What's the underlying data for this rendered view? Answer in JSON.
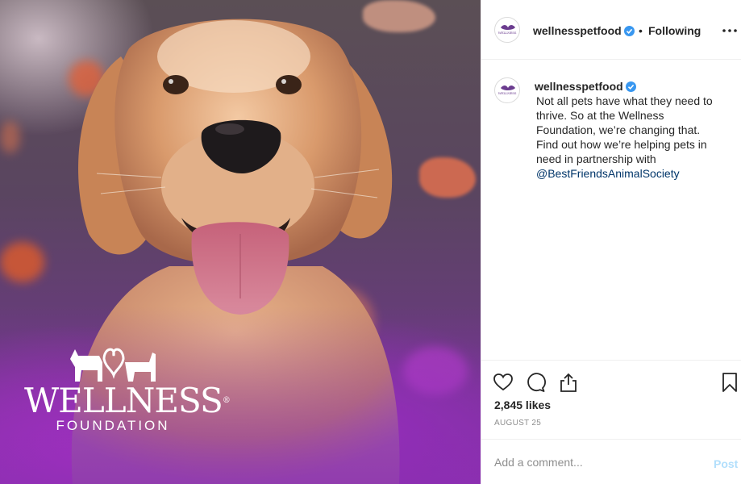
{
  "post": {
    "image_alt_icon": "golden-retriever-photo",
    "logo": {
      "wordmark": "WELLNESS",
      "registered": "®",
      "subtitle": "FOUNDATION"
    }
  },
  "header": {
    "username": "wellnesspetfood",
    "verified_icon": "verified-badge-icon",
    "separator": "•",
    "follow_status": "Following",
    "more_icon": "more-options-icon",
    "avatar_text": "WELLNESS"
  },
  "caption": {
    "username": "wellnesspetfood",
    "text": "Not all pets have what they need to thrive. So at the Wellness Foundation, we’re changing that. Find out how we’re helping pets in need in partnership with",
    "mention": "@BestFriendsAnimalSociety"
  },
  "actions": {
    "like_icon": "heart-icon",
    "comment_icon": "comment-bubble-icon",
    "share_icon": "share-icon",
    "save_icon": "bookmark-icon",
    "likes": "2,845 likes",
    "date": "AUGUST 25"
  },
  "comment_box": {
    "placeholder": "Add a comment...",
    "post_label": "Post"
  },
  "colors": {
    "accent_link": "#003569",
    "verified": "#3897f0",
    "post_disabled": "#b2dffc",
    "brand_purple": "#6b3c8f"
  }
}
